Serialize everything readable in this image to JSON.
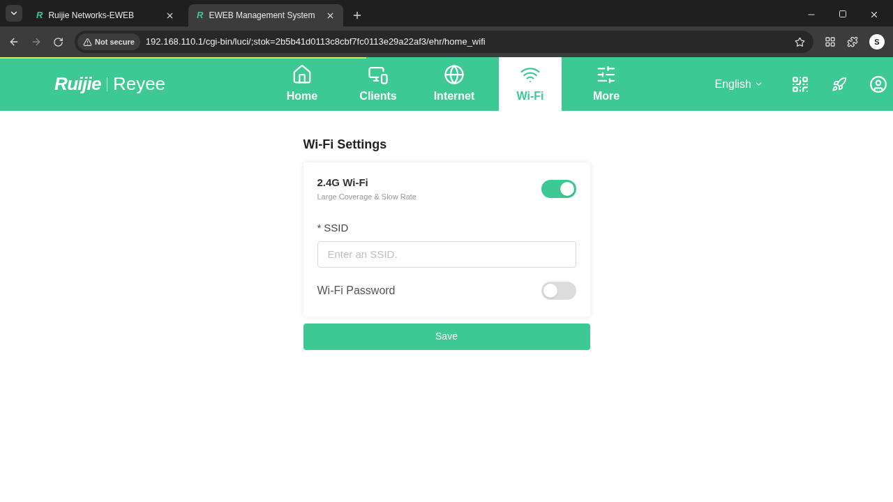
{
  "browser": {
    "tabs": [
      {
        "favicon": "R",
        "title": "Ruijie Networks-EWEB",
        "selected": false
      },
      {
        "favicon": "R",
        "title": "EWEB Management System",
        "selected": true
      }
    ],
    "security": "Not secure",
    "url": "192.168.110.1/cgi-bin/luci/;stok=2b5b41d0113c8cbf7fc0113e29a22af3/ehr/home_wifi",
    "profile": "S"
  },
  "header": {
    "loading": {
      "level": 0.41
    },
    "logo": {
      "brand": "Ruijie",
      "sub_brand": "Reyee"
    },
    "nav": [
      {
        "kind": "home",
        "label": "Home",
        "selected": false
      },
      {
        "kind": "clients",
        "label": "Clients",
        "selected": false
      },
      {
        "kind": "internet",
        "label": "Internet",
        "selected": false
      },
      {
        "kind": "wifi",
        "label": "Wi-Fi",
        "selected": true
      },
      {
        "kind": "more",
        "label": "More",
        "selected": false
      }
    ],
    "language": "English"
  },
  "settings": {
    "title": "Wi-Fi Settings",
    "band": {
      "label": "2.4G Wi-Fi",
      "description": "Large Coverage & Slow Rate",
      "on": true
    },
    "ssid": {
      "required_mark": "*",
      "label": "SSID",
      "placeholder": "Enter an SSID."
    },
    "password": {
      "label": "Wi-Fi Password",
      "on": false
    },
    "save": "Save"
  }
}
